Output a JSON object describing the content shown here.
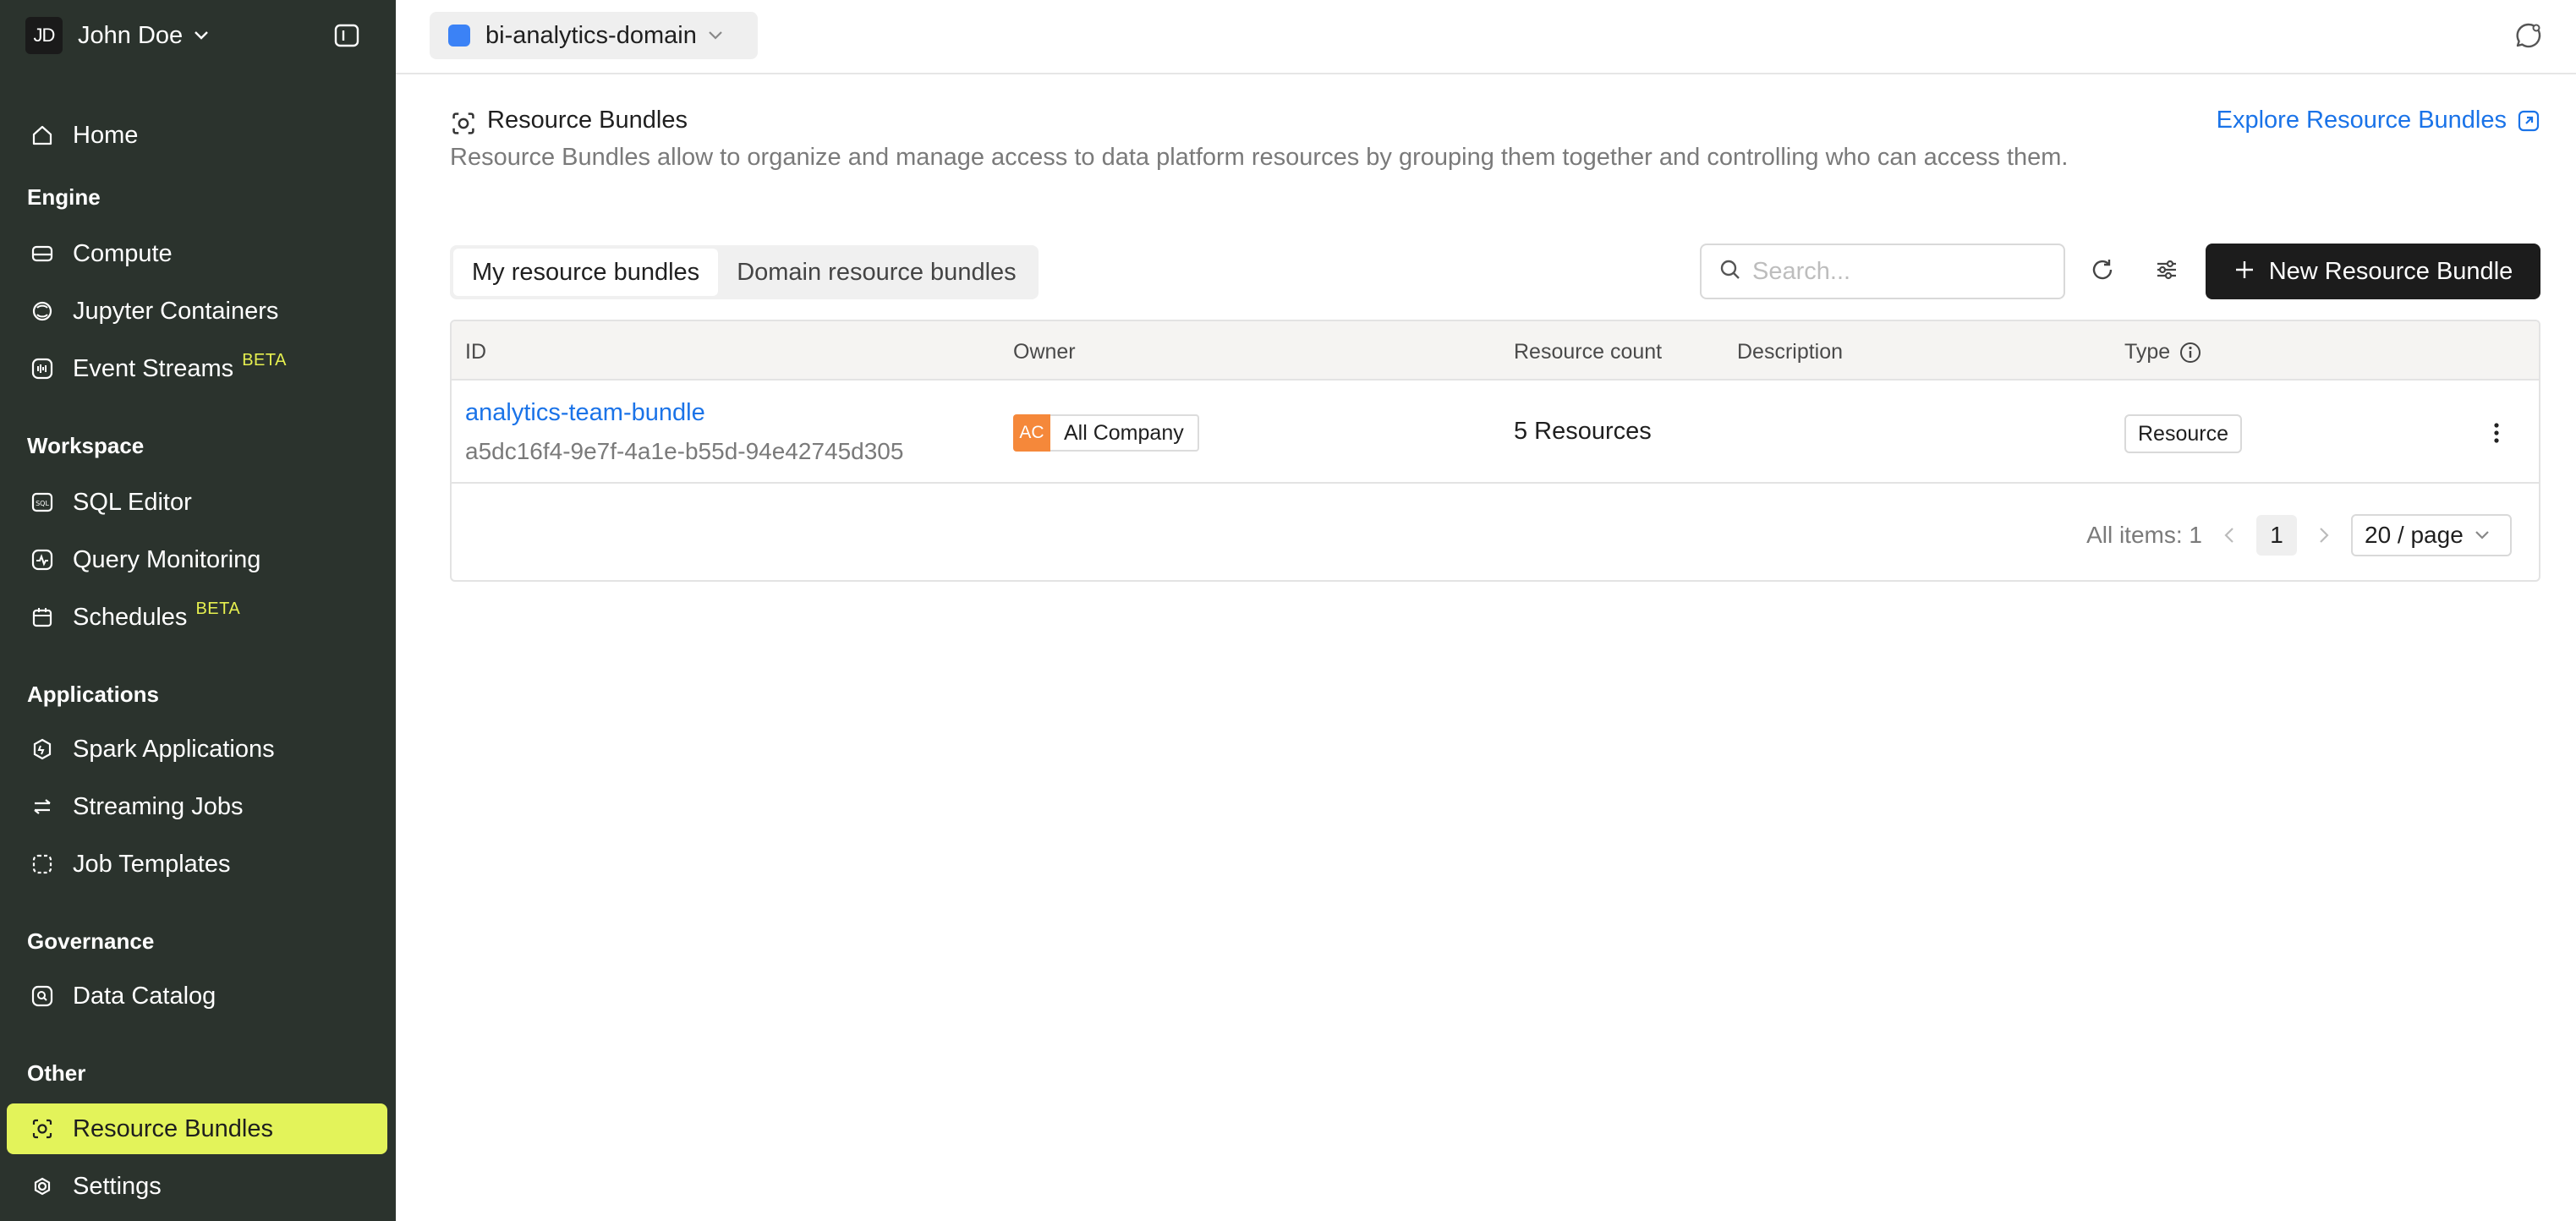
{
  "user": {
    "initials": "JD",
    "name": "John Doe"
  },
  "domain": {
    "name": "bi-analytics-domain",
    "color": "#3b82f6"
  },
  "sidebar": {
    "home": "Home",
    "sections": {
      "engine": "Engine",
      "workspace": "Workspace",
      "applications": "Applications",
      "governance": "Governance",
      "other": "Other"
    },
    "items": {
      "compute": "Compute",
      "jupyter": "Jupyter Containers",
      "event_streams": "Event Streams",
      "sql_editor": "SQL Editor",
      "query_monitoring": "Query Monitoring",
      "schedules": "Schedules",
      "spark": "Spark Applications",
      "streaming": "Streaming Jobs",
      "job_templates": "Job Templates",
      "data_catalog": "Data Catalog",
      "resource_bundles": "Resource Bundles",
      "settings": "Settings"
    },
    "beta_label": "BETA",
    "active_color": "#e3f35a"
  },
  "page": {
    "title": "Resource Bundles",
    "description": "Resource Bundles allow to organize and manage access to data platform resources by grouping them together and controlling who can access them.",
    "explore_link": "Explore Resource Bundles"
  },
  "tabs": [
    "My resource bundles",
    "Domain resource bundles"
  ],
  "active_tab": "My resource bundles",
  "search": {
    "placeholder": "Search...",
    "value": ""
  },
  "new_button": "New Resource Bundle",
  "table": {
    "columns": [
      "ID",
      "Owner",
      "Resource count",
      "Description",
      "Type"
    ],
    "rows": [
      {
        "name": "analytics-team-bundle",
        "id": "a5dc16f4-9e7f-4a1e-b55d-94e42745d305",
        "owner_initials": "AC",
        "owner": "All Company",
        "resource_count": "5 Resources",
        "description": "",
        "type": "Resource"
      }
    ]
  },
  "pagination": {
    "total": "All items: 1",
    "current": "1",
    "page_size": "20 / page"
  }
}
